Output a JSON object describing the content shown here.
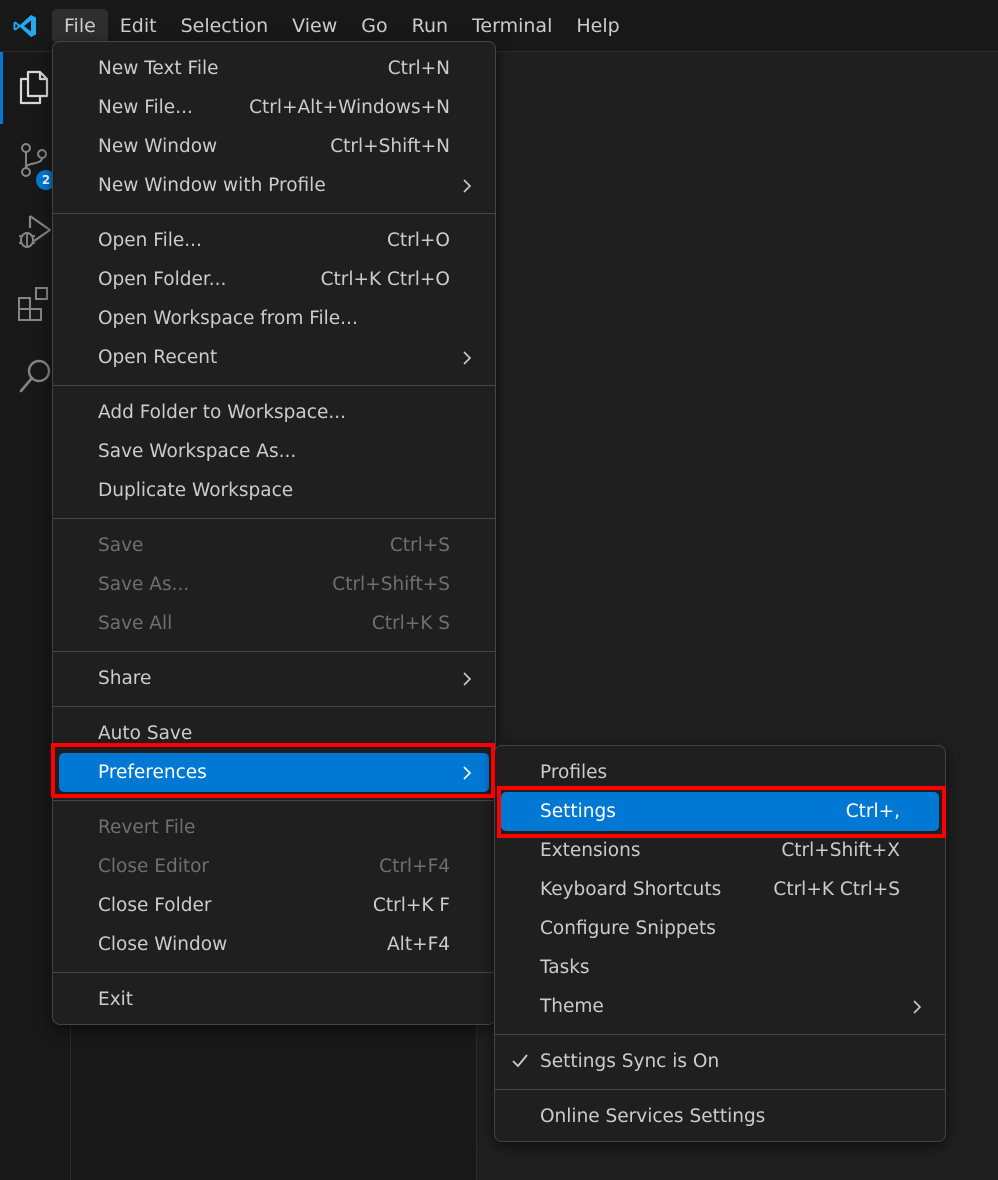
{
  "menubar": {
    "items": [
      "File",
      "Edit",
      "Selection",
      "View",
      "Go",
      "Run",
      "Terminal",
      "Help"
    ]
  },
  "activitybar": {
    "items": [
      {
        "icon": "explorer-icon",
        "active": true
      },
      {
        "icon": "source-control-icon",
        "badge": "2"
      },
      {
        "icon": "run-debug-icon"
      },
      {
        "icon": "extensions-icon"
      },
      {
        "icon": "search-icon"
      }
    ]
  },
  "file_menu": {
    "items": [
      {
        "label": "New Text File",
        "shortcut": "Ctrl+N"
      },
      {
        "label": "New File...",
        "shortcut": "Ctrl+Alt+Windows+N"
      },
      {
        "label": "New Window",
        "shortcut": "Ctrl+Shift+N"
      },
      {
        "label": "New Window with Profile",
        "submenu": true
      },
      {
        "label": "Open File...",
        "shortcut": "Ctrl+O"
      },
      {
        "label": "Open Folder...",
        "shortcut": "Ctrl+K Ctrl+O"
      },
      {
        "label": "Open Workspace from File..."
      },
      {
        "label": "Open Recent",
        "submenu": true
      },
      {
        "label": "Add Folder to Workspace..."
      },
      {
        "label": "Save Workspace As..."
      },
      {
        "label": "Duplicate Workspace"
      },
      {
        "label": "Save",
        "shortcut": "Ctrl+S",
        "disabled": true
      },
      {
        "label": "Save As...",
        "shortcut": "Ctrl+Shift+S",
        "disabled": true
      },
      {
        "label": "Save All",
        "shortcut": "Ctrl+K S",
        "disabled": true
      },
      {
        "label": "Share",
        "submenu": true
      },
      {
        "label": "Auto Save"
      },
      {
        "label": "Preferences",
        "submenu": true,
        "highlighted": true
      },
      {
        "label": "Revert File",
        "disabled": true
      },
      {
        "label": "Close Editor",
        "shortcut": "Ctrl+F4",
        "disabled": true
      },
      {
        "label": "Close Folder",
        "shortcut": "Ctrl+K F"
      },
      {
        "label": "Close Window",
        "shortcut": "Alt+F4"
      },
      {
        "label": "Exit"
      }
    ]
  },
  "preferences_menu": {
    "items": [
      {
        "label": "Profiles"
      },
      {
        "label": "Settings",
        "shortcut": "Ctrl+,",
        "highlighted": true
      },
      {
        "label": "Extensions",
        "shortcut": "Ctrl+Shift+X"
      },
      {
        "label": "Keyboard Shortcuts",
        "shortcut": "Ctrl+K Ctrl+S"
      },
      {
        "label": "Configure Snippets"
      },
      {
        "label": "Tasks"
      },
      {
        "label": "Theme",
        "submenu": true
      },
      {
        "label": "Settings Sync is On",
        "checked": true
      },
      {
        "label": "Online Services Settings"
      }
    ]
  },
  "colors": {
    "accent": "#0078d4",
    "annotation": "#ff0000",
    "logo": "#23a9f2"
  }
}
